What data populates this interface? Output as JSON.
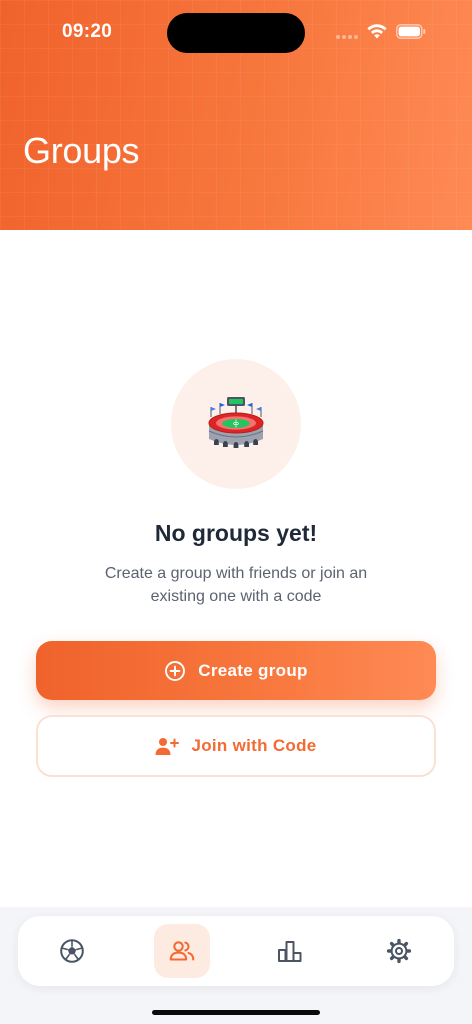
{
  "status_bar": {
    "time": "09:20"
  },
  "header": {
    "title": "Groups"
  },
  "empty_state": {
    "icon": "stadium-icon",
    "title": "No groups yet!",
    "description": "Create a group with friends or join an existing one with a code"
  },
  "actions": {
    "create_label": "Create group",
    "create_icon": "plus-circle-icon",
    "join_label": "Join with Code",
    "join_icon": "user-plus-icon"
  },
  "tab_bar": {
    "items": [
      {
        "icon": "soccer-ball-icon",
        "active": false
      },
      {
        "icon": "users-icon",
        "active": true
      },
      {
        "icon": "bar-chart-icon",
        "active": false
      },
      {
        "icon": "gear-icon",
        "active": false
      }
    ]
  },
  "colors": {
    "accent": "#f36a33",
    "accent_gradient_start": "#f0622c",
    "accent_gradient_end": "#ff8a55",
    "title_text": "#1f2937",
    "body_text": "#5b6270",
    "inactive_icon": "#4b5563"
  }
}
